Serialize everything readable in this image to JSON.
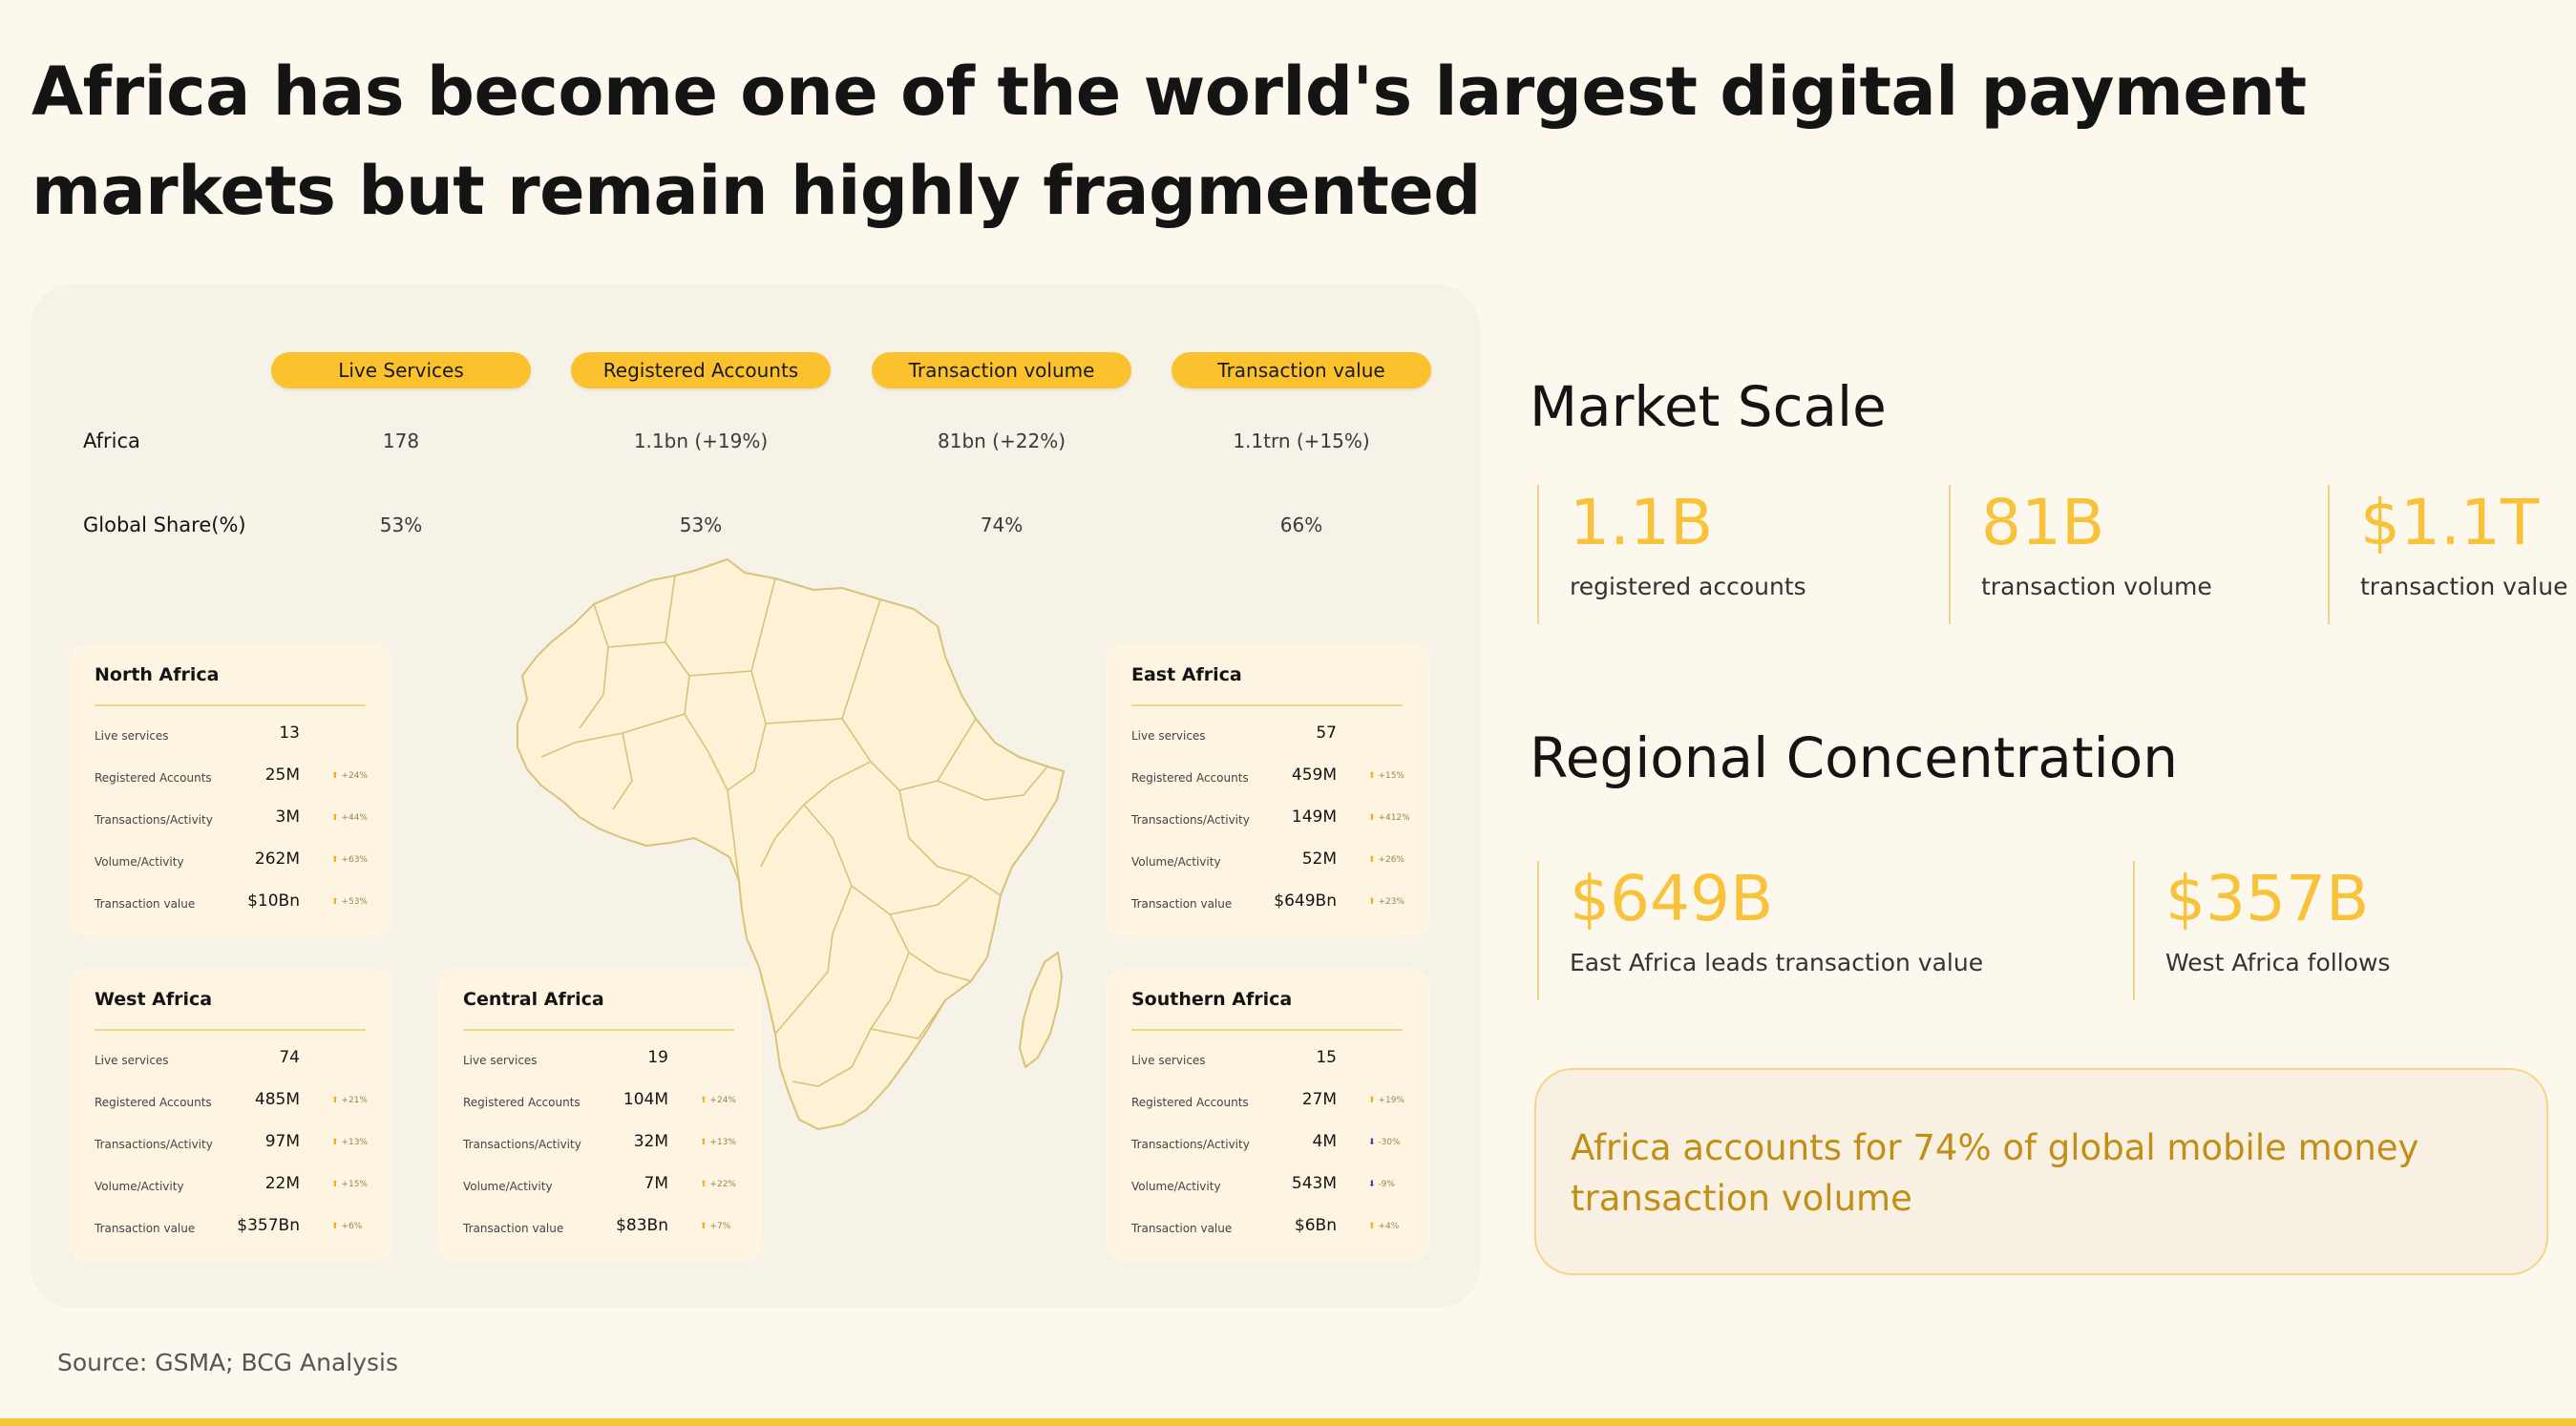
{
  "title": "Africa has become one of the world's largest digital payment markets but remain highly fragmented",
  "table": {
    "headers": [
      "Live Services",
      "Registered Accounts",
      "Transaction volume",
      "Transaction value"
    ],
    "rows": [
      {
        "label": "Africa",
        "values": [
          "178",
          "1.1bn (+19%)",
          "81bn (+22%)",
          "1.1trn (+15%)"
        ]
      },
      {
        "label": "Global Share(%)",
        "values": [
          "53%",
          "53%",
          "74%",
          "66%"
        ]
      }
    ]
  },
  "regions": [
    {
      "name": "North Africa",
      "rows": [
        {
          "label": "Live services",
          "value": "13",
          "change": ""
        },
        {
          "label": "Registered Accounts",
          "value": "25M",
          "change": "+24%",
          "dir": "up"
        },
        {
          "label": "Transactions/Activity",
          "value": "3M",
          "change": "+44%",
          "dir": "up"
        },
        {
          "label": "Volume/Activity",
          "value": "262M",
          "change": "+63%",
          "dir": "up"
        },
        {
          "label": "Transaction value",
          "value": "$10Bn",
          "change": "+53%",
          "dir": "up"
        }
      ]
    },
    {
      "name": "East Africa",
      "rows": [
        {
          "label": "Live services",
          "value": "57",
          "change": ""
        },
        {
          "label": "Registered Accounts",
          "value": "459M",
          "change": "+15%",
          "dir": "up"
        },
        {
          "label": "Transactions/Activity",
          "value": "149M",
          "change": "+412%",
          "dir": "up"
        },
        {
          "label": "Volume/Activity",
          "value": "52M",
          "change": "+26%",
          "dir": "up"
        },
        {
          "label": "Transaction value",
          "value": "$649Bn",
          "change": "+23%",
          "dir": "up"
        }
      ]
    },
    {
      "name": "West Africa",
      "rows": [
        {
          "label": "Live services",
          "value": "74",
          "change": ""
        },
        {
          "label": "Registered Accounts",
          "value": "485M",
          "change": "+21%",
          "dir": "up"
        },
        {
          "label": "Transactions/Activity",
          "value": "97M",
          "change": "+13%",
          "dir": "up"
        },
        {
          "label": "Volume/Activity",
          "value": "22M",
          "change": "+15%",
          "dir": "up"
        },
        {
          "label": "Transaction value",
          "value": "$357Bn",
          "change": "+6%",
          "dir": "up"
        }
      ]
    },
    {
      "name": "Central Africa",
      "rows": [
        {
          "label": "Live services",
          "value": "19",
          "change": ""
        },
        {
          "label": "Registered Accounts",
          "value": "104M",
          "change": "+24%",
          "dir": "up"
        },
        {
          "label": "Transactions/Activity",
          "value": "32M",
          "change": "+13%",
          "dir": "up"
        },
        {
          "label": "Volume/Activity",
          "value": "7M",
          "change": "+22%",
          "dir": "up"
        },
        {
          "label": "Transaction value",
          "value": "$83Bn",
          "change": "+7%",
          "dir": "up"
        }
      ]
    },
    {
      "name": "Southern Africa",
      "rows": [
        {
          "label": "Live services",
          "value": "15",
          "change": ""
        },
        {
          "label": "Registered Accounts",
          "value": "27M",
          "change": "+19%",
          "dir": "up"
        },
        {
          "label": "Transactions/Activity",
          "value": "4M",
          "change": "-30%",
          "dir": "down"
        },
        {
          "label": "Volume/Activity",
          "value": "543M",
          "change": "-9%",
          "dir": "down"
        },
        {
          "label": "Transaction value",
          "value": "$6Bn",
          "change": "+4%",
          "dir": "up"
        }
      ]
    }
  ],
  "market_scale": {
    "heading": "Market Scale",
    "stats": [
      {
        "value": "1.1B",
        "label": "registered accounts"
      },
      {
        "value": "81B",
        "label": "transaction volume"
      },
      {
        "value": "$1.1T",
        "label": "transaction value"
      }
    ]
  },
  "regional": {
    "heading": "Regional Concentration",
    "stats": [
      {
        "value": "$649B",
        "label": "East Africa leads transaction value"
      },
      {
        "value": "$357B",
        "label": "West Africa follows"
      }
    ]
  },
  "callout": "Africa accounts for 74% of global mobile money transaction volume",
  "source": "Source: GSMA; BCG Analysis",
  "colors": {
    "accent": "#fbc22d",
    "stat": "#f8c33a",
    "callout_text": "#c28f16",
    "background": "#fdf8ee"
  }
}
